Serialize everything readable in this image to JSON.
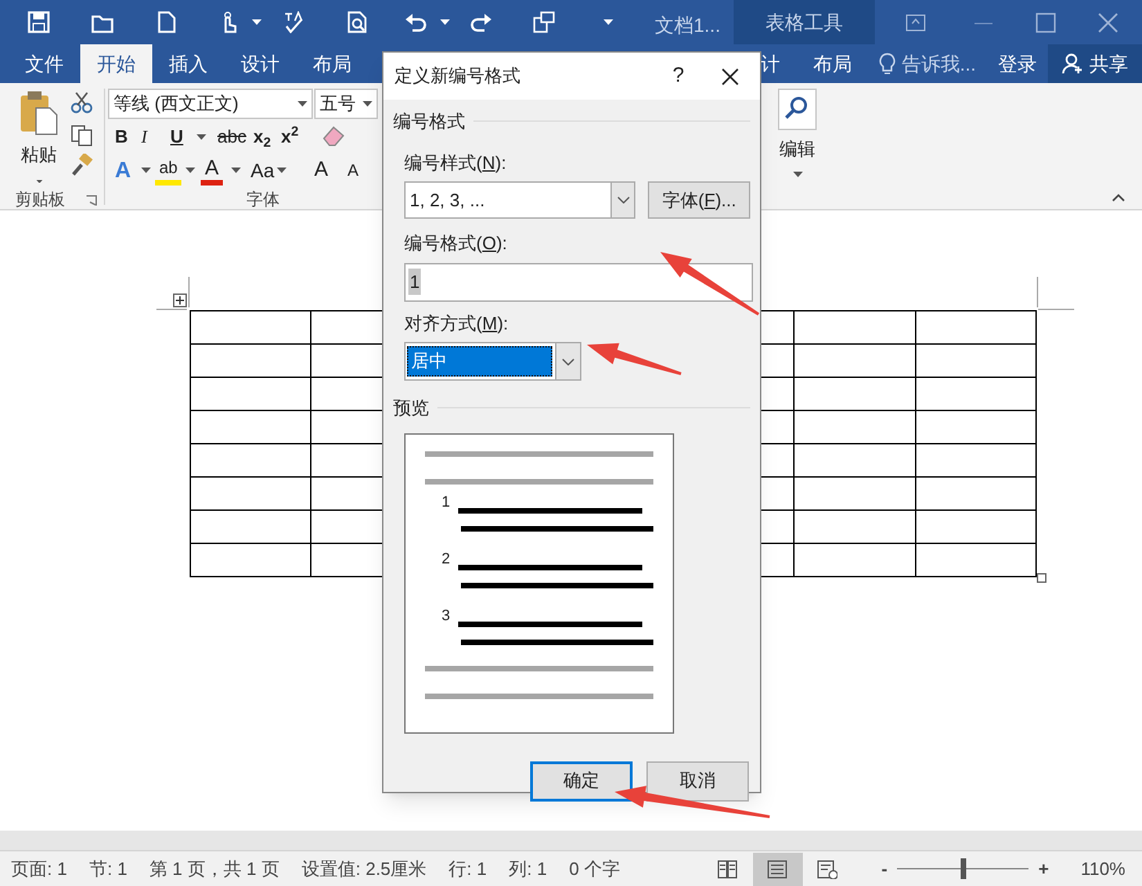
{
  "title_bar": {
    "document_title": "文档1...",
    "contextual_tab": "表格工具"
  },
  "ribbon_tabs": [
    {
      "label": "文件",
      "selected": false
    },
    {
      "label": "开始",
      "selected": true
    },
    {
      "label": "插入",
      "selected": false
    },
    {
      "label": "设计",
      "selected": false
    },
    {
      "label": "布局",
      "selected": false
    }
  ],
  "ribbon_tabs_right": [
    {
      "label": "计",
      "selected": false
    },
    {
      "label": "布局",
      "selected": false
    }
  ],
  "tell_me": "告诉我...",
  "sign_in": "登录",
  "share": "共享",
  "clipboard": {
    "paste": "粘贴",
    "group_label": "剪贴板"
  },
  "font": {
    "font_name": "等线 (西文正文)",
    "font_size": "五号",
    "group_label": "字体",
    "row1": [
      {
        "kind": "bold",
        "text": "B"
      },
      {
        "kind": "italic",
        "text": "I"
      },
      {
        "kind": "underline",
        "text": "U"
      },
      {
        "kind": "strike",
        "text": "abc"
      },
      {
        "kind": "plain",
        "text": "x$_{2}$"
      },
      {
        "kind": "plain",
        "text": "x$^{2}$"
      }
    ],
    "row2": [
      {
        "kind": "effects",
        "text": "A"
      },
      {
        "kind": "highlight",
        "text": "ab"
      },
      {
        "kind": "color",
        "text": "A"
      },
      {
        "kind": "case",
        "text": "Aa"
      },
      {
        "kind": "grow",
        "text": "A"
      },
      {
        "kind": "shrink",
        "text": "A"
      }
    ]
  },
  "editing": {
    "label": "编辑"
  },
  "dialog": {
    "title": "定义新编号格式",
    "help": "?",
    "section": "编号格式",
    "style_label": {
      "text": "编号样式(",
      "key": "N",
      "suffix": "):"
    },
    "style_value": "1, 2, 3, ...",
    "font_button": {
      "text": "字体(",
      "key": "F",
      "suffix": ")..."
    },
    "format_label": {
      "text": "编号格式(",
      "key": "O",
      "suffix": "):"
    },
    "format_value": "1",
    "align_label": {
      "text": "对齐方式(",
      "key": "M",
      "suffix": "):"
    },
    "align_value": "居中",
    "preview_label": "预览",
    "preview_numbers": [
      "1",
      "2",
      "3"
    ],
    "buttons": [
      {
        "label": "确定",
        "default": true
      },
      {
        "label": "取消",
        "default": false
      }
    ]
  },
  "status_bar": [
    "页面: 1",
    "节: 1",
    "第 1 页，共 1 页",
    "设置值: 2.5厘米",
    "行: 1",
    "列: 1",
    "0 个字"
  ],
  "views": [
    {
      "kind": "read",
      "selected": false
    },
    {
      "kind": "print",
      "selected": true
    },
    {
      "kind": "web",
      "selected": false
    }
  ],
  "zoom": {
    "minus": "-",
    "plus": "+",
    "level": 0.5,
    "percent": "110%"
  }
}
